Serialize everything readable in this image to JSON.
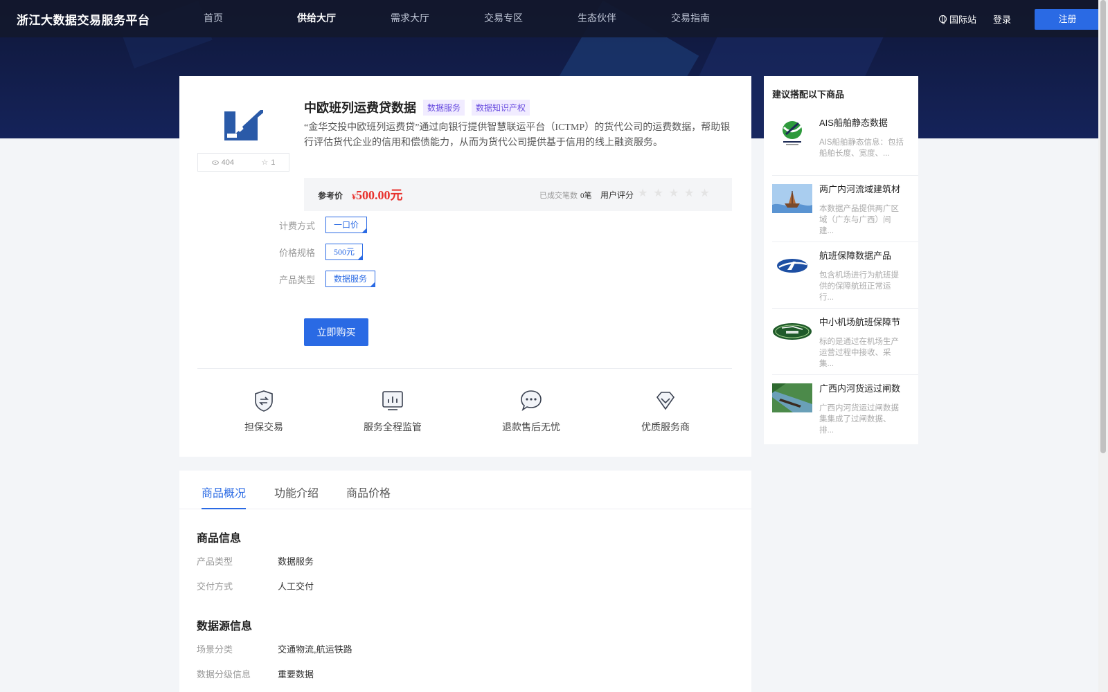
{
  "header": {
    "logo": "浙江大数据交易服务平台",
    "nav": [
      {
        "label": "首页",
        "active": false
      },
      {
        "label": "供给大厅",
        "active": true
      },
      {
        "label": "需求大厅",
        "active": false
      },
      {
        "label": "交易专区",
        "active": false
      },
      {
        "label": "生态伙伴",
        "active": false
      },
      {
        "label": "交易指南",
        "active": false
      }
    ],
    "international": "国际站",
    "login": "登录",
    "register": "注册"
  },
  "product": {
    "views": "404",
    "favorites": "1",
    "title": "中欧班列运费贷数据",
    "tags": [
      "数据服务",
      "数据知识产权"
    ],
    "description": "“金华交投中欧班列运费贷”通过向银行提供智慧联运平台（ICTMP）的货代公司的运费数据，帮助银行评估货代企业的信用和偿债能力，从而为货代公司提供基于信用的线上融资服务。",
    "price_label": "参考价",
    "currency": "¥",
    "price": "500.00元",
    "deals_label": "已成交笔数",
    "deals_value": "0笔",
    "rating_label": "用户评分",
    "rating": 0,
    "specs": [
      {
        "label": "计费方式",
        "value": "一口价"
      },
      {
        "label": "价格规格",
        "value": "500元"
      },
      {
        "label": "产品类型",
        "value": "数据服务"
      }
    ],
    "buy_button": "立即购买",
    "features": [
      {
        "label": "担保交易",
        "icon": "shield-exchange-icon"
      },
      {
        "label": "服务全程监管",
        "icon": "monitor-chart-icon"
      },
      {
        "label": "退款售后无忧",
        "icon": "chat-bubble-icon"
      },
      {
        "label": "优质服务商",
        "icon": "diamond-icon"
      }
    ]
  },
  "detail": {
    "tabs": [
      {
        "label": "商品概况",
        "active": true
      },
      {
        "label": "功能介绍",
        "active": false
      },
      {
        "label": "商品价格",
        "active": false
      }
    ],
    "product_info_title": "商品信息",
    "product_info": [
      {
        "key": "产品类型",
        "value": "数据服务"
      },
      {
        "key": "交付方式",
        "value": "人工交付"
      }
    ],
    "source_info_title": "数据源信息",
    "source_info": [
      {
        "key": "场景分类",
        "value": "交通物流,航运铁路"
      },
      {
        "key": "数据分级信息",
        "value": "重要数据"
      }
    ]
  },
  "recommend": {
    "title": "建议搭配以下商品",
    "items": [
      {
        "name": "AIS船舶静态数据",
        "desc": "AIS船舶静态信息：包括船舶长度、宽度、...",
        "thumb": "ais-logo"
      },
      {
        "name": "两广内河流域建筑材",
        "desc": "本数据产品提供两广区域（广东与广西）间建...",
        "thumb": "ship-photo"
      },
      {
        "name": "航班保障数据产品",
        "desc": "包含机场进行为航班提供的保障航班正常运行...",
        "thumb": "airline-logo"
      },
      {
        "name": "中小机场航班保障节",
        "desc": "标的是通过在机场生产运营过程中接收、采集...",
        "thumb": "uamc-logo"
      },
      {
        "name": "广西内河货运过闸数",
        "desc": "广西内河货运过闸数据集集成了过闸数据、排...",
        "thumb": "river-photo"
      }
    ]
  },
  "colors": {
    "accent": "#2a6ae4",
    "price": "#e8312d",
    "header_bg": "#0f1738",
    "tag_bg": "#f1ecff",
    "tag_text": "#6a4ee0"
  }
}
